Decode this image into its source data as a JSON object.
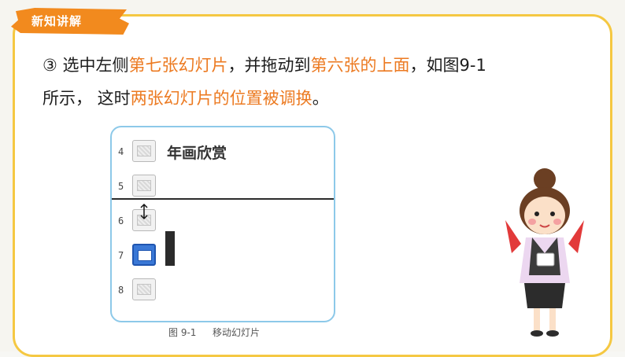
{
  "header": {
    "section_label": "新知讲解"
  },
  "instruction": {
    "step_marker": "③",
    "seg1": " 选中左侧",
    "hl1": "第七张幻灯片",
    "seg2": "，并拖动到",
    "hl2": "第六张的上面",
    "seg3": "，如图9-1",
    "seg4": "所示， 这时",
    "hl3": "两张幻灯片的位置被调换",
    "seg5": "。"
  },
  "screenshot": {
    "slides": [
      {
        "num": "4",
        "title": "年画欣赏",
        "selected": false
      },
      {
        "num": "5",
        "title": "",
        "selected": false
      },
      {
        "num": "6",
        "title": "",
        "selected": false
      },
      {
        "num": "7",
        "title": "",
        "selected": true
      },
      {
        "num": "8",
        "title": "",
        "selected": false
      }
    ]
  },
  "caption": {
    "number": "图 9-1",
    "text": "移动幻灯片"
  },
  "colors": {
    "accent_orange": "#ec7a21",
    "frame_yellow": "#f5c842",
    "panel_border": "#8dc9e9",
    "selected_blue": "#3a78d6"
  },
  "icons": [
    "drag-cursor-icon",
    "teacher-illustration"
  ]
}
